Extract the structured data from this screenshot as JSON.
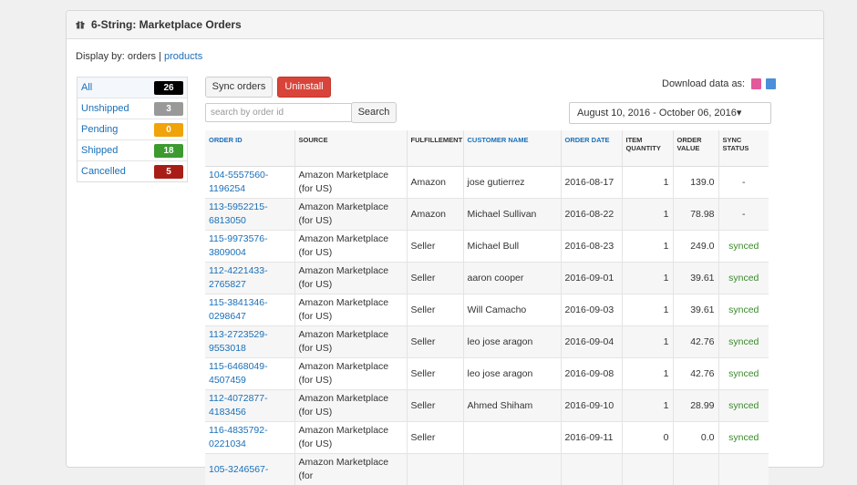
{
  "header": {
    "title": "6-String: Marketplace Orders"
  },
  "display_by": {
    "prefix": "Display by: orders |",
    "link": "products"
  },
  "filters": [
    {
      "label": "All",
      "count": "26",
      "color": "#000000"
    },
    {
      "label": "Unshipped",
      "count": "3",
      "color": "#999999"
    },
    {
      "label": "Pending",
      "count": "0",
      "color": "#f0a30a"
    },
    {
      "label": "Shipped",
      "count": "18",
      "color": "#3c9a2f"
    },
    {
      "label": "Cancelled",
      "count": "5",
      "color": "#a81e16"
    }
  ],
  "toolbar": {
    "sync_label": "Sync orders",
    "uninstall_label": "Uninstall",
    "search_label": "Search",
    "search_placeholder": "search by order id"
  },
  "download": {
    "label": "Download data as:",
    "icons": [
      "csv-file-icon",
      "xls-file-icon"
    ]
  },
  "date_range": "August 10, 2016 - October 06, 2016▾",
  "table": {
    "headers": [
      "ORDER ID",
      "SOURCE",
      "FULFILLEMENT",
      "CUSTOMER NAME",
      "ORDER DATE",
      "ITEM QUANTITY",
      "ORDER VALUE",
      "SYNC STATUS"
    ],
    "rows": [
      {
        "order_id": "104-5557560-1196254",
        "source": "Amazon Marketplace (for US)",
        "fulfillment": "Amazon",
        "customer": "jose gutierrez",
        "date": "2016-08-17",
        "qty": "1",
        "value": "139.0",
        "sync": "-"
      },
      {
        "order_id": "113-5952215-6813050",
        "source": "Amazon Marketplace (for US)",
        "fulfillment": "Amazon",
        "customer": "Michael Sullivan",
        "date": "2016-08-22",
        "qty": "1",
        "value": "78.98",
        "sync": "-"
      },
      {
        "order_id": "115-9973576-3809004",
        "source": "Amazon Marketplace (for US)",
        "fulfillment": "Seller",
        "customer": "Michael Bull",
        "date": "2016-08-23",
        "qty": "1",
        "value": "249.0",
        "sync": "synced"
      },
      {
        "order_id": "112-4221433-2765827",
        "source": "Amazon Marketplace (for US)",
        "fulfillment": "Seller",
        "customer": "aaron cooper",
        "date": "2016-09-01",
        "qty": "1",
        "value": "39.61",
        "sync": "synced"
      },
      {
        "order_id": "115-3841346-0298647",
        "source": "Amazon Marketplace (for US)",
        "fulfillment": "Seller",
        "customer": "Will Camacho",
        "date": "2016-09-03",
        "qty": "1",
        "value": "39.61",
        "sync": "synced"
      },
      {
        "order_id": "113-2723529-9553018",
        "source": "Amazon Marketplace (for US)",
        "fulfillment": "Seller",
        "customer": "leo jose aragon",
        "date": "2016-09-04",
        "qty": "1",
        "value": "42.76",
        "sync": "synced"
      },
      {
        "order_id": "115-6468049-4507459",
        "source": "Amazon Marketplace (for US)",
        "fulfillment": "Seller",
        "customer": "leo jose aragon",
        "date": "2016-09-08",
        "qty": "1",
        "value": "42.76",
        "sync": "synced"
      },
      {
        "order_id": "112-4072877-4183456",
        "source": "Amazon Marketplace (for US)",
        "fulfillment": "Seller",
        "customer": "Ahmed Shiham",
        "date": "2016-09-10",
        "qty": "1",
        "value": "28.99",
        "sync": "synced"
      },
      {
        "order_id": "116-4835792-0221034",
        "source": "Amazon Marketplace (for US)",
        "fulfillment": "Seller",
        "customer": "",
        "date": "2016-09-11",
        "qty": "0",
        "value": "0.0",
        "sync": "synced"
      },
      {
        "order_id": "105-3246567-",
        "source": "Amazon Marketplace (for",
        "fulfillment": "",
        "customer": "",
        "date": "",
        "qty": "",
        "value": "",
        "sync": ""
      }
    ]
  }
}
